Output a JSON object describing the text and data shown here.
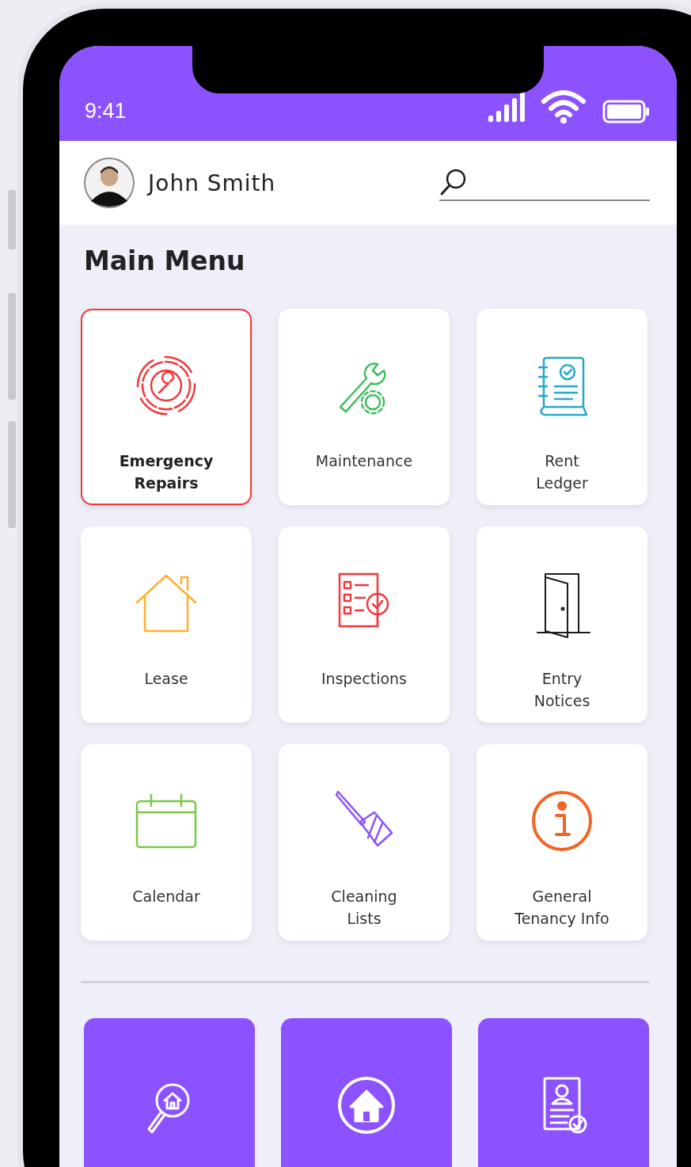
{
  "status_bar": {
    "time": "9:41"
  },
  "header": {
    "user_name": "John Smith"
  },
  "menu": {
    "title": "Main Menu",
    "items": [
      {
        "label": "Emergency\nRepairs",
        "kind": "repair",
        "color": "#f0393c",
        "selected": true
      },
      {
        "label": "Maintenance",
        "kind": "wrench",
        "color": "#3cbf5c",
        "selected": false
      },
      {
        "label": "Rent\nLedger",
        "kind": "ledger",
        "color": "#23a9c9",
        "selected": false
      },
      {
        "label": "Lease",
        "kind": "house",
        "color": "#ffb02e",
        "selected": false
      },
      {
        "label": "Inspections",
        "kind": "checklist",
        "color": "#f0393c",
        "selected": false
      },
      {
        "label": "Entry\nNotices",
        "kind": "door",
        "color": "#1a1a1a",
        "selected": false
      },
      {
        "label": "Calendar",
        "kind": "calendar",
        "color": "#7ac943",
        "selected": false
      },
      {
        "label": "Cleaning\nLists",
        "kind": "broom",
        "color": "#8c52ff",
        "selected": false
      },
      {
        "label": "General\nTenancy Info",
        "kind": "info",
        "color": "#f26522",
        "selected": false
      }
    ]
  },
  "bottom_nav": [
    {
      "kind": "search-house"
    },
    {
      "kind": "home"
    },
    {
      "kind": "profile-doc"
    }
  ]
}
